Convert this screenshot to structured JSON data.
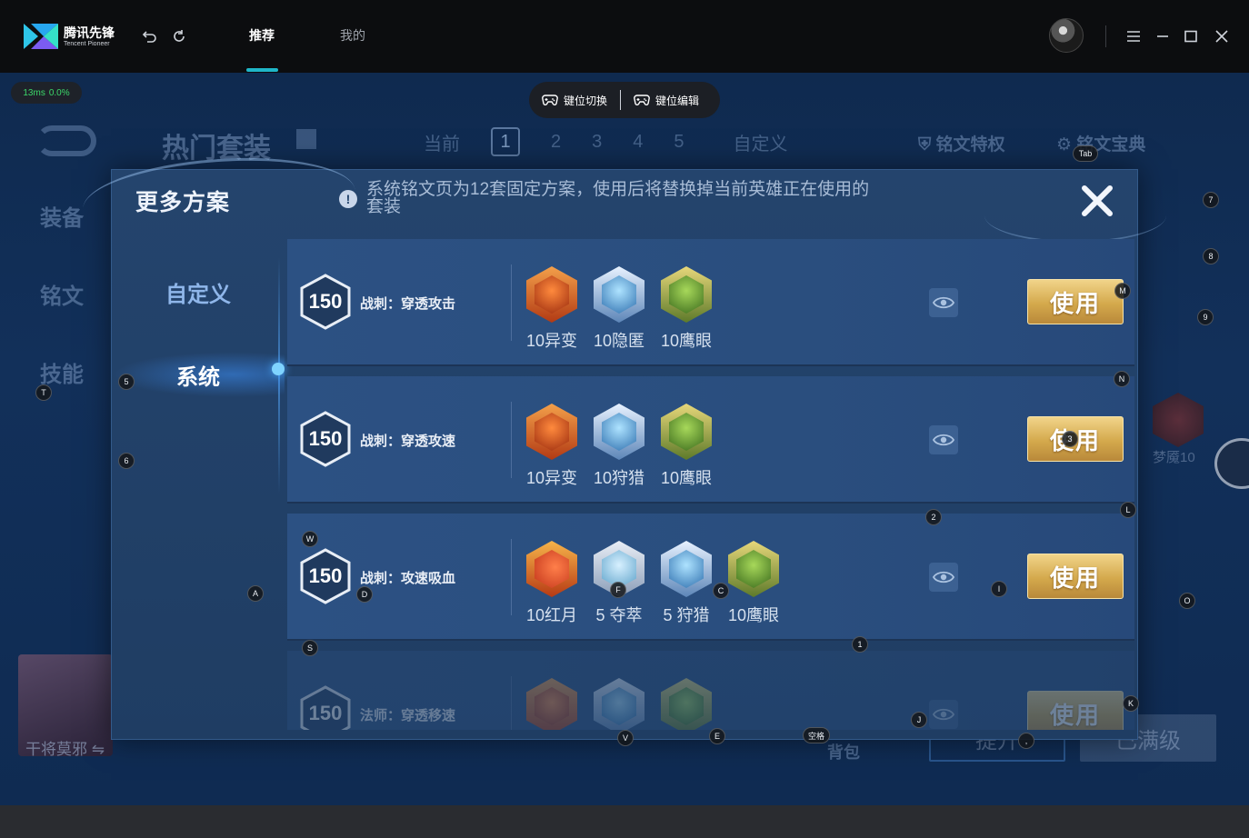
{
  "app": {
    "logo_cn": "腾讯先锋",
    "logo_en": "Tencent Pioneer",
    "tabs": [
      "推荐",
      "我的"
    ],
    "active_tab": "推荐"
  },
  "status": {
    "latency": "13ms",
    "loss": "0.0%"
  },
  "key_pill": {
    "switch_label": "键位切换",
    "edit_label": "键位编辑"
  },
  "background": {
    "header_title": "热门套装",
    "tabs": [
      "当前",
      "1",
      "2",
      "3",
      "4",
      "5",
      "自定义"
    ],
    "feature1": "铭文特权",
    "feature2": "铭文宝典",
    "side_items": [
      "装备",
      "铭文",
      "技能"
    ],
    "hero_name": "干将莫邪",
    "right_label": "梦魇10",
    "backpack": "背包",
    "upgrade_btn": "提升",
    "maxed_btn": "已满级"
  },
  "modal": {
    "title": "更多方案",
    "notice_line1": "系统铭文页为12套固定方案，使用后将替换掉当前英雄正在使用的",
    "notice_line2": "套装",
    "side_menu": [
      "自定义",
      "系统"
    ],
    "active_side": "系统",
    "use_label": "使用",
    "plans": [
      {
        "level": "150",
        "name": "战刺：穿透攻击",
        "runes": [
          {
            "label": "10异变",
            "color": "red"
          },
          {
            "label": "10隐匿",
            "color": "blue"
          },
          {
            "label": "10鹰眼",
            "color": "green"
          }
        ]
      },
      {
        "level": "150",
        "name": "战刺：穿透攻速",
        "runes": [
          {
            "label": "10异变",
            "color": "red"
          },
          {
            "label": "10狩猎",
            "color": "blue"
          },
          {
            "label": "10鹰眼",
            "color": "green"
          }
        ]
      },
      {
        "level": "150",
        "name": "战刺：攻速吸血",
        "runes": [
          {
            "label": "10红月",
            "color": "moon"
          },
          {
            "label": "5 夺萃",
            "color": "pale"
          },
          {
            "label": "5 狩猎",
            "color": "blue"
          },
          {
            "label": "10鹰眼",
            "color": "green"
          }
        ]
      },
      {
        "level": "150",
        "name": "法师：穿透移速",
        "runes": [
          {
            "label": "",
            "color": "red"
          },
          {
            "label": "",
            "color": "blue"
          },
          {
            "label": "",
            "color": "green"
          }
        ]
      }
    ]
  },
  "key_hints": [
    "Tab",
    "7",
    "8",
    "M",
    "9",
    "N",
    "T",
    "5",
    "6",
    "3",
    "2",
    "L",
    "W",
    "A",
    "D",
    "F",
    "C",
    "I",
    "O",
    "S",
    "1",
    "K",
    "J",
    "V",
    "E",
    "空格",
    ","
  ]
}
